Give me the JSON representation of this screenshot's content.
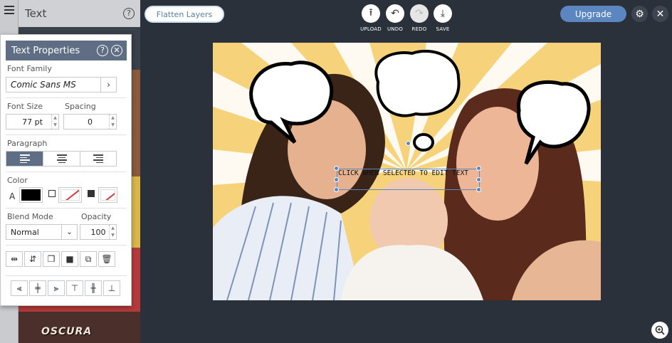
{
  "side": {
    "title": "Text",
    "thumb_label": "OSCURA"
  },
  "text_properties": {
    "title": "Text Properties",
    "font_family_label": "Font Family",
    "font_family_value": "Comic Sans MS",
    "font_size_label": "Font Size",
    "font_size_value": "77 pt",
    "spacing_label": "Spacing",
    "spacing_value": "0",
    "paragraph_label": "Paragraph",
    "color_label": "Color",
    "color_letter": "A",
    "text_color": "#000000",
    "blend_label": "Blend Mode",
    "blend_value": "Normal",
    "opacity_label": "Opacity",
    "opacity_value": "100"
  },
  "toolbar": {
    "flatten_label": "Flatten Layers",
    "upload_label": "UPLOAD",
    "undo_label": "UNDO",
    "redo_label": "REDO",
    "save_label": "SAVE",
    "upgrade_label": "Upgrade"
  },
  "canvas": {
    "caption": "CLICK WHEN SELECTED TO EDIT TEXT"
  },
  "colors": {
    "accent": "#5b86bf",
    "panel_header": "#5f6e84",
    "workspace": "#2b313a"
  }
}
